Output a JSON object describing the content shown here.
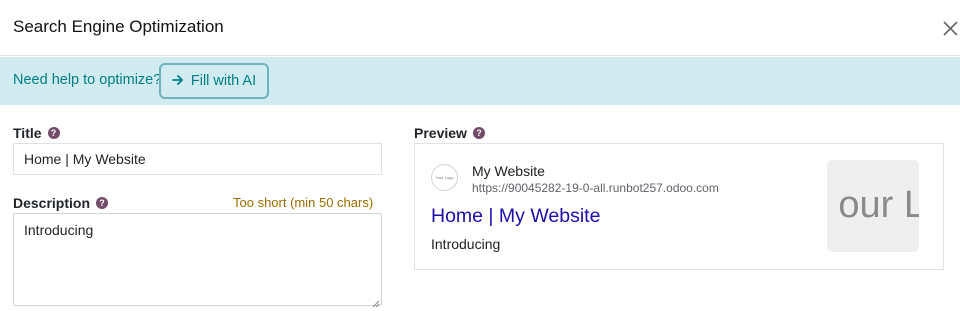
{
  "dialog": {
    "title": "Search Engine Optimization"
  },
  "banner": {
    "help_text": "Need help to optimize?",
    "ai_button_label": "Fill with AI"
  },
  "form": {
    "title_label": "Title",
    "title_value": "Home | My Website",
    "description_label": "Description",
    "description_warning": "Too short (min 50 chars)",
    "description_value": "Introducing"
  },
  "preview": {
    "label": "Preview",
    "logo_text": "Your Logo",
    "site_name": "My Website",
    "site_url": "https://90045282-19-0-all.runbot257.odoo.com",
    "seo_title": "Home | My Website",
    "seo_description": "Introducing",
    "thumbnail_text": "our L"
  },
  "colors": {
    "accent": "#017e84",
    "banner_bg": "#d1ecf1",
    "link_blue": "#1a0dab",
    "help_icon": "#714b67",
    "warning": "#9a6d00"
  }
}
